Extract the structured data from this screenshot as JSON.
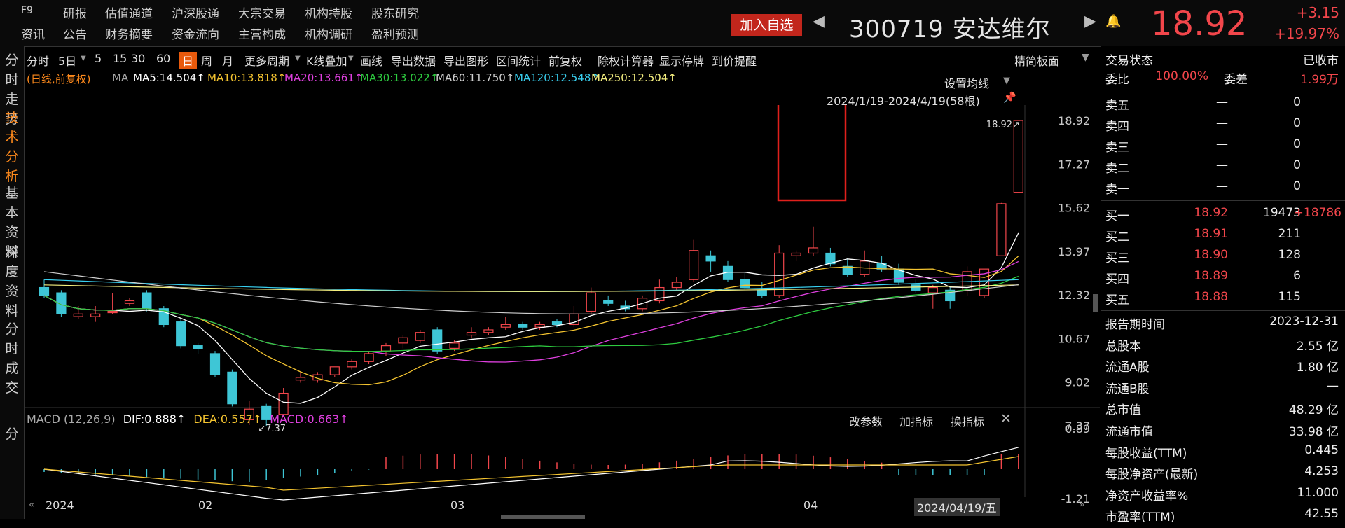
{
  "nav": {
    "row1": [
      "F9",
      "研报",
      "估值通道",
      "沪深股通",
      "大宗交易",
      "机构持股",
      "股东研究"
    ],
    "row2": [
      "资讯",
      "公告",
      "财务摘要",
      "资金流向",
      "主营构成",
      "机构调研",
      "盈利预测"
    ]
  },
  "header": {
    "add_watch": "加入自选",
    "code_name": "300719 安达维尔",
    "price": "18.92",
    "change": "+3.15",
    "change_pct": "+19.97%"
  },
  "leftnav": [
    "分时走势",
    "技术分析",
    "基本资料",
    "深度资料",
    "分时成交",
    "分"
  ],
  "toolbar": {
    "items": [
      "分时",
      "5日",
      "5",
      "15",
      "30",
      "60",
      "日",
      "周",
      "月",
      "更多周期",
      "K线叠加",
      "画线",
      "导出数据",
      "导出图形",
      "区间统计",
      "前复权",
      "除权计算器",
      "显示停牌",
      "到价提醒"
    ],
    "selected": "日",
    "simple_board": "精简板面",
    "set_ma": "设置均线"
  },
  "ma_legend": {
    "mode": "(日线,前复权)",
    "ma": "MA",
    "items": [
      {
        "label": "MA5:14.504↑",
        "color": "#ffffff"
      },
      {
        "label": "MA10:13.818↑",
        "color": "#f4c430"
      },
      {
        "label": "MA20:13.661↑",
        "color": "#e040e0"
      },
      {
        "label": "MA30:13.022↑",
        "color": "#2ecc40"
      },
      {
        "label": "MA60:11.750↑",
        "color": "#cfcfcf"
      },
      {
        "label": "MA120:12.548↑",
        "color": "#39d0f0"
      },
      {
        "label": "MA250:12.504↑",
        "color": "#f6f080"
      }
    ]
  },
  "date_range": "2024/1/19-2024/4/19(58根)",
  "price_axis": [
    "18.92",
    "17.27",
    "15.62",
    "13.97",
    "12.32",
    "10.67",
    "9.02",
    "7.37"
  ],
  "annotations": {
    "high": "18.92",
    "low": "7.37"
  },
  "macd": {
    "title": "MACD (12,26,9)",
    "dif": "DIF:0.888↑",
    "dea": "DEA:0.557↑",
    "macd": "MACD:0.663↑",
    "controls": [
      "改参数",
      "加指标",
      "换指标"
    ],
    "axis": [
      "0.89",
      "-1.21"
    ]
  },
  "x_axis": [
    "2024",
    "02",
    "03",
    "04"
  ],
  "current_date": "2024/04/19/五",
  "right_panel": {
    "status_label": "交易状态",
    "status_value": "已收市",
    "webi_label": "委比",
    "webi_value": "100.00%",
    "weicha_label": "委差",
    "weicha_value": "1.99万",
    "asks": [
      {
        "label": "卖五",
        "price": "—",
        "vol": "0"
      },
      {
        "label": "卖四",
        "price": "—",
        "vol": "0"
      },
      {
        "label": "卖三",
        "price": "—",
        "vol": "0"
      },
      {
        "label": "卖二",
        "price": "—",
        "vol": "0"
      },
      {
        "label": "卖一",
        "price": "—",
        "vol": "0"
      }
    ],
    "bids": [
      {
        "label": "买一",
        "price": "18.92",
        "vol": "19473",
        "extra": "+18786"
      },
      {
        "label": "买二",
        "price": "18.91",
        "vol": "211",
        "extra": ""
      },
      {
        "label": "买三",
        "price": "18.90",
        "vol": "128",
        "extra": ""
      },
      {
        "label": "买四",
        "price": "18.89",
        "vol": "6",
        "extra": ""
      },
      {
        "label": "买五",
        "price": "18.88",
        "vol": "115",
        "extra": ""
      }
    ],
    "fundamentals": [
      {
        "label": "报告期时间",
        "value": "2023-12-31"
      },
      {
        "label": "总股本",
        "value": "2.55 亿"
      },
      {
        "label": "流通A股",
        "value": "1.80 亿"
      },
      {
        "label": "流通B股",
        "value": "—"
      },
      {
        "label": "总市值",
        "value": "48.29 亿"
      },
      {
        "label": "流通市值",
        "value": "33.98 亿"
      },
      {
        "label": "每股收益(TTM)",
        "value": "0.445"
      },
      {
        "label": "每股净资产(最新)",
        "value": "4.253"
      },
      {
        "label": "净资产收益率%",
        "value": "11.000"
      },
      {
        "label": "市盈率(TTM)",
        "value": "42.55"
      }
    ]
  },
  "chart_data": {
    "type": "candlestick",
    "ylim": [
      7.37,
      18.92
    ],
    "candles": [
      [
        12.6,
        12.9,
        12.3,
        12.2,
        "down"
      ],
      [
        12.4,
        12.5,
        11.6,
        11.5,
        "down"
      ],
      [
        11.6,
        11.9,
        11.5,
        11.4,
        "up"
      ],
      [
        11.5,
        11.9,
        11.6,
        11.3,
        "up"
      ],
      [
        11.7,
        12.4,
        11.7,
        11.6,
        "up"
      ],
      [
        12.0,
        12.2,
        12.1,
        11.9,
        "up"
      ],
      [
        12.4,
        12.5,
        11.8,
        11.7,
        "down"
      ],
      [
        11.8,
        11.9,
        11.2,
        11.1,
        "down"
      ],
      [
        11.3,
        11.4,
        10.4,
        10.3,
        "down"
      ],
      [
        10.4,
        10.5,
        10.3,
        10.1,
        "down"
      ],
      [
        10.1,
        10.2,
        9.3,
        9.2,
        "down"
      ],
      [
        9.4,
        9.5,
        8.2,
        8.1,
        "down"
      ],
      [
        8.0,
        8.3,
        7.6,
        7.4,
        "up"
      ],
      [
        8.1,
        8.2,
        7.6,
        7.37,
        "down"
      ],
      [
        7.8,
        8.8,
        8.6,
        7.7,
        "up"
      ],
      [
        9.2,
        9.4,
        9.1,
        9.0,
        "up"
      ],
      [
        9.1,
        9.4,
        9.3,
        9.0,
        "up"
      ],
      [
        9.3,
        9.6,
        9.6,
        9.2,
        "up"
      ],
      [
        9.6,
        9.9,
        9.8,
        9.5,
        "up"
      ],
      [
        9.8,
        10.2,
        10.1,
        9.7,
        "up"
      ],
      [
        10.2,
        10.5,
        10.4,
        10.0,
        "up"
      ],
      [
        10.5,
        10.8,
        10.7,
        10.3,
        "up"
      ],
      [
        10.6,
        11.0,
        10.9,
        10.5,
        "up"
      ],
      [
        11.0,
        11.1,
        10.2,
        10.1,
        "down"
      ],
      [
        10.3,
        10.6,
        10.5,
        10.2,
        "up"
      ],
      [
        10.8,
        11.1,
        10.9,
        10.7,
        "up"
      ],
      [
        10.9,
        11.1,
        11.0,
        10.8,
        "up"
      ],
      [
        11.2,
        11.5,
        11.1,
        11.0,
        "up"
      ],
      [
        11.1,
        11.3,
        11.2,
        11.0,
        "down"
      ],
      [
        11.1,
        11.3,
        11.2,
        11.0,
        "up"
      ],
      [
        11.2,
        11.4,
        11.3,
        11.1,
        "down"
      ],
      [
        11.2,
        11.9,
        11.6,
        11.1,
        "up"
      ],
      [
        11.7,
        12.6,
        12.4,
        11.6,
        "up"
      ],
      [
        12.1,
        12.3,
        12.0,
        11.9,
        "down"
      ],
      [
        11.9,
        12.1,
        11.8,
        11.7,
        "down"
      ],
      [
        11.8,
        12.3,
        12.2,
        11.7,
        "up"
      ],
      [
        12.1,
        12.9,
        12.6,
        12.0,
        "up"
      ],
      [
        12.6,
        13.0,
        12.8,
        12.5,
        "up"
      ],
      [
        12.9,
        14.4,
        14.0,
        12.8,
        "up"
      ],
      [
        13.8,
        14.0,
        13.6,
        13.2,
        "down"
      ],
      [
        13.4,
        13.6,
        12.9,
        12.8,
        "down"
      ],
      [
        12.9,
        13.2,
        12.6,
        12.5,
        "down"
      ],
      [
        12.5,
        12.8,
        12.3,
        12.2,
        "down"
      ],
      [
        12.3,
        14.2,
        13.9,
        12.2,
        "up"
      ],
      [
        13.9,
        14.0,
        13.8,
        13.6,
        "up"
      ],
      [
        13.9,
        14.9,
        14.1,
        13.8,
        "up"
      ],
      [
        13.9,
        14.1,
        13.5,
        13.4,
        "down"
      ],
      [
        13.4,
        13.7,
        13.1,
        13.0,
        "down"
      ],
      [
        13.1,
        14.0,
        13.6,
        13.0,
        "up"
      ],
      [
        13.5,
        13.8,
        13.3,
        13.2,
        "down"
      ],
      [
        13.3,
        13.5,
        12.8,
        12.7,
        "down"
      ],
      [
        12.7,
        12.9,
        12.5,
        12.4,
        "down"
      ],
      [
        12.6,
        12.7,
        12.4,
        11.8,
        "up"
      ],
      [
        12.5,
        12.6,
        12.1,
        11.8,
        "down"
      ],
      [
        12.5,
        13.4,
        13.2,
        12.3,
        "up"
      ],
      [
        12.3,
        13.3,
        13.3,
        12.2,
        "up"
      ],
      [
        13.8,
        15.8,
        15.77,
        13.8,
        "up"
      ],
      [
        16.2,
        18.92,
        18.92,
        16.2,
        "up"
      ]
    ]
  }
}
